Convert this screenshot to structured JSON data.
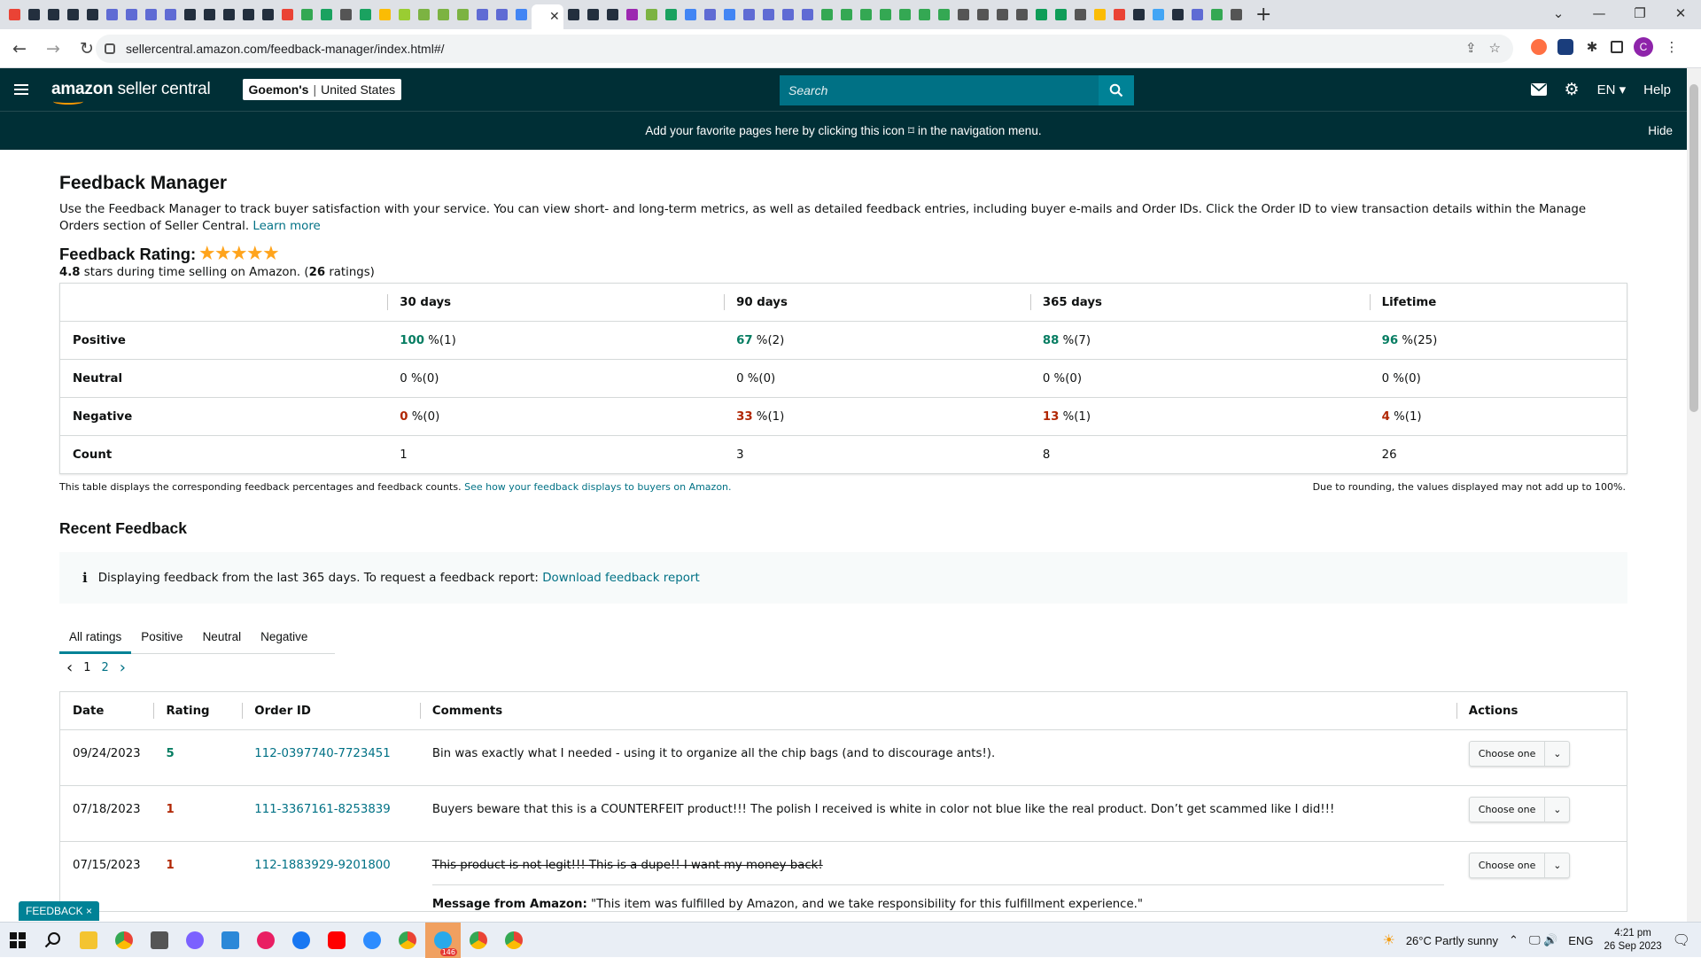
{
  "browser": {
    "url": "sellercentral.amazon.com/feedback-manager/index.html#/",
    "tab_colors": [
      "#ea4335",
      "#232f3e",
      "#232f3e",
      "#232f3e",
      "#232f3e",
      "#5f6bd4",
      "#5f6bd4",
      "#5f6bd4",
      "#5f6bd4",
      "#232f3e",
      "#232f3e",
      "#232f3e",
      "#232f3e",
      "#232f3e",
      "#ea4335",
      "#34a853",
      "#1aa260",
      "#555",
      "#1aa260",
      "#fbbc04",
      "#9acd32",
      "#7cb342",
      "#7cb342",
      "#7cb342",
      "#5f6bd4",
      "#5f6bd4",
      "#4285f4"
    ],
    "tab_colors_right": [
      "#232f3e",
      "#232f3e",
      "#232f3e",
      "#9c27b0",
      "#7cb342",
      "#1aa260",
      "#4285f4",
      "#5f6bd4",
      "#4285f4",
      "#5f6bd4",
      "#5f6bd4",
      "#5f6bd4",
      "#5f6bd4",
      "#34a853",
      "#34a853",
      "#34a853",
      "#34a853",
      "#34a853",
      "#34a853",
      "#34a853",
      "#555",
      "#555",
      "#555",
      "#555",
      "#0f9d58",
      "#0f9d58",
      "#555",
      "#fbbc04",
      "#ea4335",
      "#232f3e",
      "#42a5f5",
      "#232f3e",
      "#5f6bd4",
      "#34a853",
      "#555"
    ],
    "profile_letter": "C"
  },
  "header": {
    "logo_amazon": "amazon",
    "logo_rest": " seller central",
    "account_name": "Goemon's",
    "account_sep": "|",
    "account_region": "United States",
    "search_placeholder": "Search",
    "lang": "EN",
    "help": "Help",
    "fav_message": "Add your favorite pages here by clicking this icon",
    "fav_message_end": "in the navigation menu.",
    "hide": "Hide"
  },
  "page": {
    "title": "Feedback Manager",
    "intro": "Use the Feedback Manager to track buyer satisfaction with your service. You can view short- and long-term metrics, as well as detailed feedback entries, including buyer e-mails and Order IDs. Click the Order ID to view transaction details within the Manage Orders section of Seller Central.",
    "learn_more": "Learn more",
    "rating_title": "Feedback Rating:",
    "stars": "★★★★★",
    "rating_value": "4.8",
    "rating_text": "stars during time selling on Amazon. (",
    "rating_count": "26",
    "rating_text_end": "ratings)"
  },
  "metrics": {
    "headers": [
      "",
      "30 days",
      "90 days",
      "365 days",
      "Lifetime"
    ],
    "rows": [
      {
        "label": "Positive",
        "cells": [
          {
            "pct": "100",
            "cnt": " %(1)"
          },
          {
            "pct": "67",
            "cnt": " %(2)"
          },
          {
            "pct": "88",
            "cnt": " %(7)"
          },
          {
            "pct": "96",
            "cnt": " %(25)"
          }
        ]
      },
      {
        "label": "Neutral",
        "cells": [
          {
            "pct": "0",
            "cnt": " %(0)"
          },
          {
            "pct": "0",
            "cnt": " %(0)"
          },
          {
            "pct": "0",
            "cnt": " %(0)"
          },
          {
            "pct": "0",
            "cnt": " %(0)"
          }
        ]
      },
      {
        "label": "Negative",
        "cells": [
          {
            "pct": "0",
            "cnt": " %(0)"
          },
          {
            "pct": "33",
            "cnt": " %(1)"
          },
          {
            "pct": "13",
            "cnt": " %(1)"
          },
          {
            "pct": "4",
            "cnt": " %(1)"
          }
        ]
      },
      {
        "label": "Count",
        "cells": [
          {
            "pct": "",
            "cnt": "1"
          },
          {
            "pct": "",
            "cnt": "3"
          },
          {
            "pct": "",
            "cnt": "8"
          },
          {
            "pct": "",
            "cnt": "26"
          }
        ]
      }
    ],
    "note_left": "This table displays the corresponding feedback percentages and feedback counts.",
    "note_link": "See how your feedback displays to buyers on Amazon.",
    "note_right": "Due to rounding, the values displayed may not add up to 100%."
  },
  "recent": {
    "title": "Recent Feedback",
    "alert_text": "Displaying feedback from the last 365 days. To request a feedback report:",
    "alert_link": "Download feedback report",
    "tabs": [
      "All ratings",
      "Positive",
      "Neutral",
      "Negative"
    ],
    "pages": [
      "1",
      "2"
    ],
    "columns": [
      "Date",
      "Rating",
      "Order ID",
      "Comments",
      "Actions"
    ],
    "rows": [
      {
        "date": "09/24/2023",
        "rating": "5",
        "order": "112-0397740-7723451",
        "comment": "Bin was exactly what I needed - using it to organize all the chip bags (and to discourage ants!).",
        "action": "Choose one"
      },
      {
        "date": "07/18/2023",
        "rating": "1",
        "order": "111-3367161-8253839",
        "comment": "Buyers beware that this is a COUNTERFEIT product!!! The polish I received is white in color not blue like the real product. Don’t get scammed like I did!!!",
        "action": "Choose one"
      },
      {
        "date": "07/15/2023",
        "rating": "1",
        "order": "112-1883929-9201800",
        "comment": "This product is not legit!!! This is a dupe!! I want my money back!",
        "action": "Choose one",
        "msg_label": "Message from Amazon:",
        "msg_text": " \"This item was fulfilled by Amazon, and we take responsibility for this fulfillment experience.\""
      }
    ]
  },
  "feedback_button": "FEEDBACK ×",
  "taskbar": {
    "weather": "26°C  Partly sunny",
    "lang": "ENG",
    "time": "4:21 pm",
    "date": "26 Sep 2023",
    "telegram_badge": "146"
  }
}
